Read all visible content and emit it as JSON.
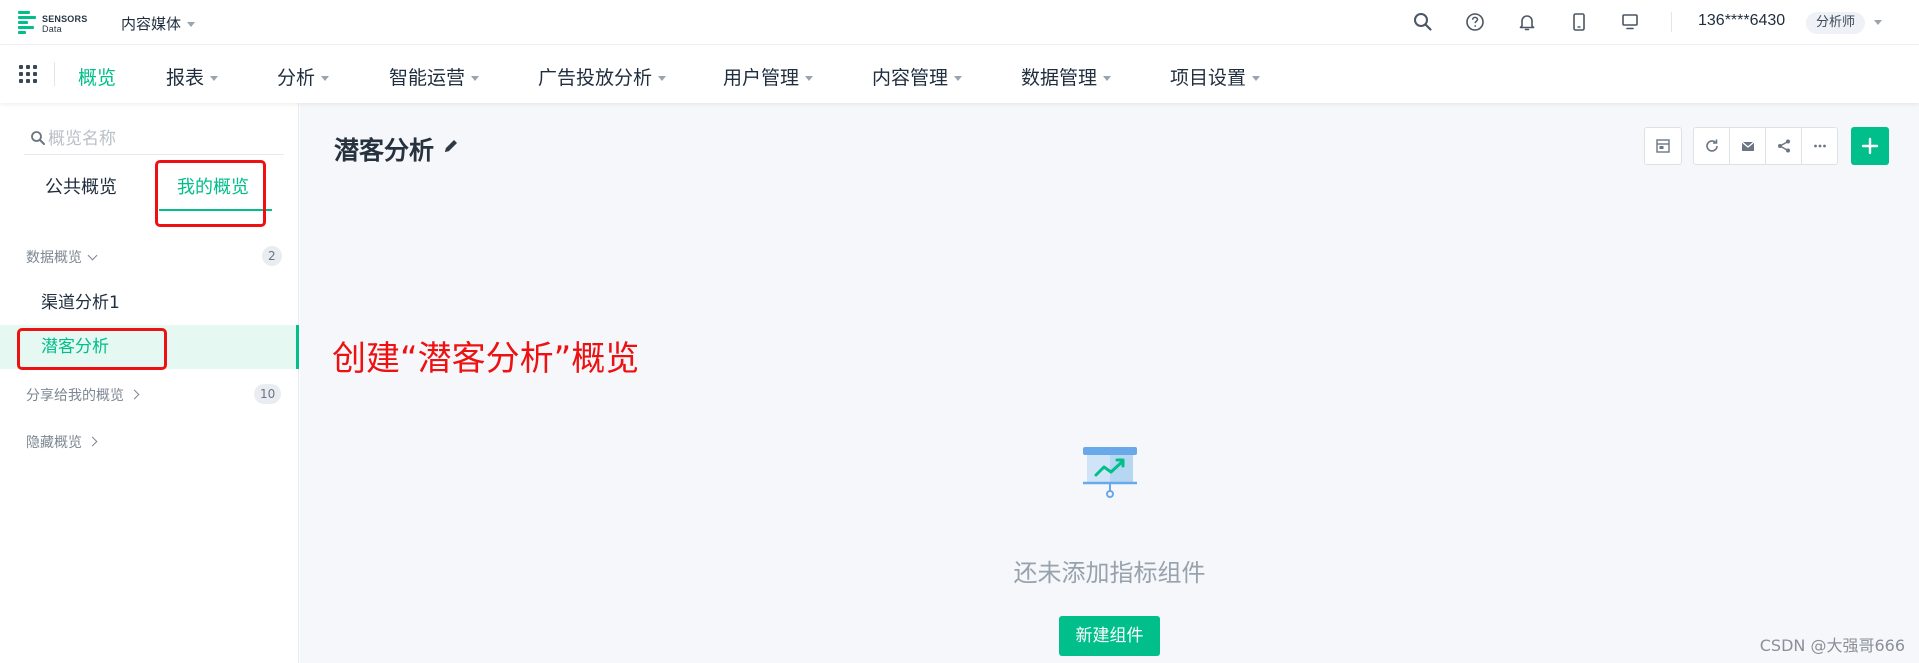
{
  "header": {
    "logo_text": "SENSORS",
    "logo_sub": "Data",
    "project": "内容媒体",
    "user_phone": "136****6430",
    "role": "分析师",
    "icons": [
      "search-icon",
      "help-icon",
      "bell-icon",
      "mobile-icon",
      "monitor-icon"
    ]
  },
  "nav": {
    "items": [
      {
        "label": "概览",
        "active": true
      },
      {
        "label": "报表"
      },
      {
        "label": "分析"
      },
      {
        "label": "智能运营"
      },
      {
        "label": "广告投放分析"
      },
      {
        "label": "用户管理"
      },
      {
        "label": "内容管理"
      },
      {
        "label": "数据管理"
      },
      {
        "label": "项目设置"
      }
    ]
  },
  "sidebar": {
    "search_placeholder": "概览名称",
    "tabs": [
      {
        "label": "公共概览"
      },
      {
        "label": "我的概览",
        "active": true
      }
    ],
    "groups": [
      {
        "label": "数据概览",
        "count": "2"
      },
      {
        "label": "分享给我的概览",
        "count": "10"
      },
      {
        "label": "隐藏概览"
      }
    ],
    "items": [
      {
        "label": "渠道分析1"
      },
      {
        "label": "潜客分析",
        "active": true
      }
    ]
  },
  "main": {
    "title": "潜客分析",
    "annotation": "创建“潜客分析”概览",
    "empty_text": "还未添加指标组件",
    "new_button": "新建组件"
  },
  "watermark": "CSDN @大强哥666",
  "colors": {
    "accent": "#00bf8a",
    "annotation_red": "#ee1111",
    "main_bg": "#f5f7fa"
  }
}
